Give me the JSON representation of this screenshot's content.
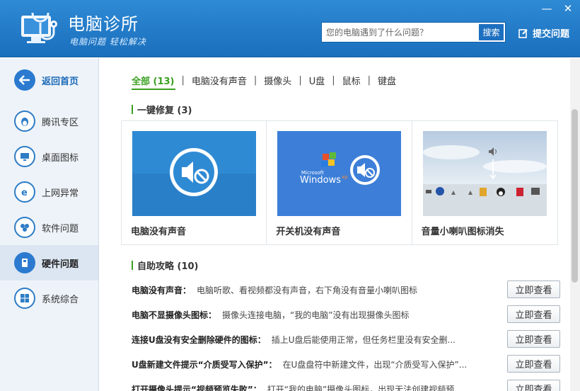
{
  "header": {
    "app_title": "电脑诊所",
    "app_slogan": "电脑问题  轻松解决",
    "search": {
      "placeholder": "您的电脑遇到了什么问题？",
      "button_label": "搜索"
    },
    "feedback_label": "提交问题",
    "window_controls": {
      "minimize": "—",
      "close": "✕"
    }
  },
  "sidebar": {
    "items": [
      {
        "label": "返回首页",
        "icon": "back-arrow-icon"
      },
      {
        "label": "腾讯专区",
        "icon": "qq-penguin-icon"
      },
      {
        "label": "桌面图标",
        "icon": "monitor-icon"
      },
      {
        "label": "上网异常",
        "icon": "ie-browser-icon"
      },
      {
        "label": "软件问题",
        "icon": "software-icon"
      },
      {
        "label": "硬件问题",
        "icon": "hardware-icon"
      },
      {
        "label": "系统综合",
        "icon": "windows-logo-icon"
      }
    ],
    "active_index": 5
  },
  "tabs": [
    "全部 (13)",
    "电脑没有声音",
    "摄像头",
    "U盘",
    "鼠标",
    "键盘"
  ],
  "quick_fix": {
    "title": "一键修复 (3)",
    "cards": [
      {
        "title": "电脑没有声音"
      },
      {
        "title": "开关机没有声音",
        "windows_text": "Windows",
        "windows_brand": "Microsoft",
        "windows_edition": "xp"
      },
      {
        "title": "音量小喇叭图标消失"
      }
    ]
  },
  "self_help": {
    "title": "自助攻略 (10)",
    "button_label": "立即查看",
    "items": [
      {
        "title": "电脑没有声音：",
        "desc": "电脑听歌、看视频都没有声音，右下角没有音量小喇叭图标"
      },
      {
        "title": "电脑不显摄像头图标：",
        "desc": "摄像头连接电脑，“我的电脑”没有出现摄像头图标"
      },
      {
        "title": "连接U盘没有安全删除硬件的图标：",
        "desc": "插上U盘后能使用正常，但任务栏里没有安全删..."
      },
      {
        "title": "U盘新建文件提示“介质受写入保护”：",
        "desc": "在U盘盘符中新建文件，出现“介质受写入保护”..."
      },
      {
        "title": "打开摄像头提示“视频预览失败”：",
        "desc": "打开“我的电脑”摄像头图标，出现无法创建视频预..."
      }
    ]
  },
  "colors": {
    "header_blue": "#1f78c8",
    "accent_green": "#3aa020",
    "card_blue": "#2f8ad4"
  }
}
